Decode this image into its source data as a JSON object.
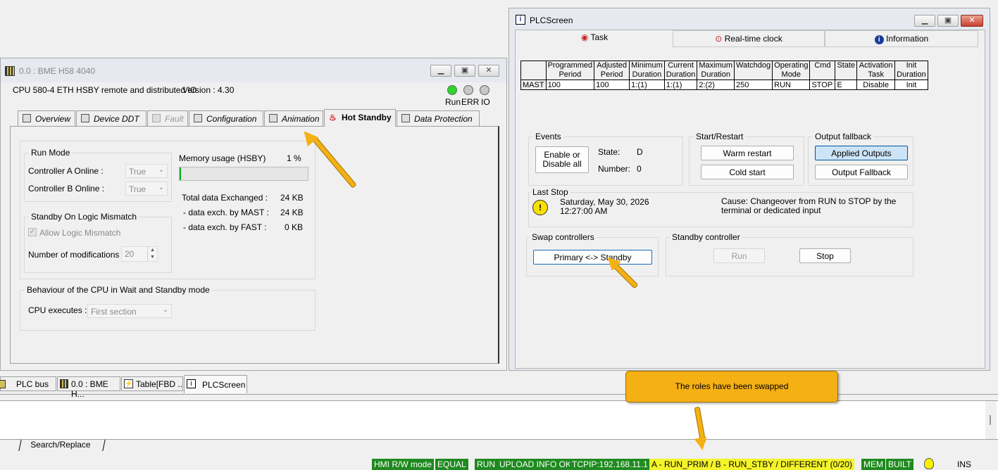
{
  "bme": {
    "title": "0.0 : BME H58 4040",
    "cpu": "CPU 580-4 ETH HSBY remote and distributed IO",
    "version": "Version : 4.30",
    "leds": {
      "run": "Run",
      "err": "ERR",
      "io": "IO"
    },
    "tabs": [
      "Overview",
      "Device DDT",
      "Fault",
      "Configuration",
      "Animation",
      "Hot Standby",
      "Data Protection"
    ],
    "run_mode": {
      "title": "Run Mode",
      "a_label": "Controller A Online :",
      "a_value": "True",
      "b_label": "Controller B Online :",
      "b_value": "True"
    },
    "mismatch": {
      "title": "Standby On Logic Mismatch",
      "allow": "Allow Logic Mismatch",
      "nmod_label": "Number of modifications :",
      "nmod_value": "20"
    },
    "memory": {
      "label": "Memory usage (HSBY)",
      "value": "1 %",
      "usage_fraction": 0.01
    },
    "exch": {
      "total_label": "Total data Exchanged :",
      "total": "24 KB",
      "mast_label": "- data exch. by MAST :",
      "mast": "24 KB",
      "fast_label": "- data exch. by FAST :",
      "fast": "0 KB"
    },
    "behaviour": {
      "title": "Behaviour of the CPU in Wait and Standby mode",
      "exec_label": "CPU executes :",
      "exec_value": "First section"
    }
  },
  "plc": {
    "title": "PLCScreen",
    "tabs": [
      "Task",
      "Real-time clock",
      "Information"
    ],
    "headers": [
      [
        "Programmed",
        "Period"
      ],
      [
        "Adjusted",
        "Period"
      ],
      [
        "Minimum",
        "Duration"
      ],
      [
        "Current",
        "Duration"
      ],
      [
        "Maximum",
        "Duration"
      ],
      [
        "Watchdog",
        ""
      ],
      [
        "Operating",
        "Mode"
      ],
      [
        "Cmd",
        ""
      ],
      [
        "State",
        ""
      ],
      [
        "Activation",
        "Task"
      ],
      [
        "Init",
        "Duration"
      ]
    ],
    "row": [
      "MAST",
      "100",
      "100",
      "1:(1)",
      "1:(1)",
      "2:(2)",
      "250",
      "RUN",
      "STOP",
      "E",
      "Disable",
      "Init"
    ],
    "events": {
      "title": "Events",
      "btn": "Enable or Disable all",
      "state_label": "State:",
      "state": "D",
      "number_label": "Number:",
      "number": "0"
    },
    "restart": {
      "title": "Start/Restart",
      "warm": "Warm restart",
      "cold": "Cold start"
    },
    "fallback": {
      "title": "Output fallback",
      "applied": "Applied Outputs",
      "fallback": "Output Fallback"
    },
    "last_stop": {
      "title": "Last Stop",
      "date": "Saturday, May 30, 2026",
      "time": "12:27:00 AM",
      "cause": "Cause: Changeover from RUN to STOP by the terminal or dedicated input"
    },
    "swap": {
      "title": "Swap controllers",
      "btn": "Primary <-> Standby"
    },
    "standby": {
      "title": "Standby controller",
      "run": "Run",
      "stop": "Stop"
    }
  },
  "taskbar": [
    "PLC bus",
    "0.0 : BME H...",
    "Table[FBD ...",
    "PLCScreen"
  ],
  "callout": "The roles have been swapped",
  "search_tab": "Search/Replace",
  "status": [
    "HMI R/W mode",
    "EQUAL",
    "RUN",
    "UPLOAD INFO OK",
    "TCPIP:192.168.11.1",
    "A - RUN_PRIM / B - RUN_STBY / DIFFERENT (0/20)",
    "MEM",
    "BUILT",
    "INS"
  ],
  "colors": {
    "status_green": "#1f8a1f",
    "status_yellow": "#f4f42a",
    "callout": "#f5b014",
    "selected_blue": "#cce4f7"
  }
}
